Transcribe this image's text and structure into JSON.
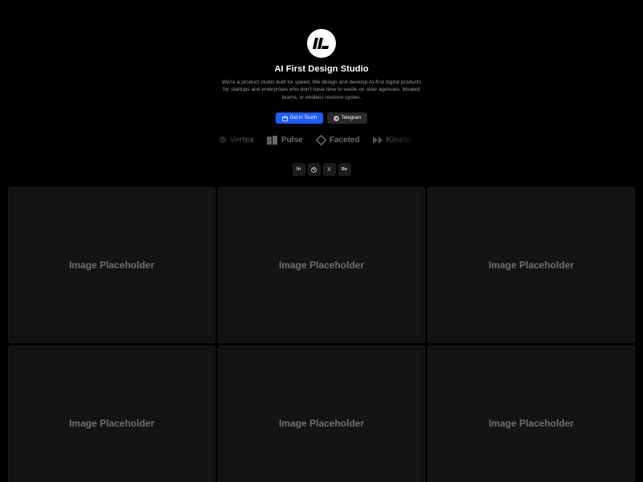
{
  "hero": {
    "title": "AI First Design Studio",
    "description": "We're a product studio built for speed. We design and develop AI-first digital products for startups and enterprises who don't have time to waste on slow agencies, bloated teams, or endless revision cycles.",
    "cta_primary": "Get in Touch",
    "cta_secondary": "Telegram",
    "cta_primary_color": "#1f5cff"
  },
  "logos": [
    {
      "name": "Vertex",
      "icon": "circle-icon"
    },
    {
      "name": "Pulse",
      "icon": "bars-icon"
    },
    {
      "name": "Faceted",
      "icon": "diamond-icon"
    },
    {
      "name": "Kineto",
      "icon": "fast-forward-icon"
    }
  ],
  "socials": [
    {
      "label": "in",
      "icon": "linkedin-icon"
    },
    {
      "label": "dribbble",
      "icon": "dribbble-icon"
    },
    {
      "label": "X",
      "icon": "x-icon"
    },
    {
      "label": "Be",
      "icon": "behance-icon"
    }
  ],
  "gallery": {
    "placeholder_label": "Image Placeholder",
    "items": [
      "Image Placeholder",
      "Image Placeholder",
      "Image Placeholder",
      "Image Placeholder",
      "Image Placeholder",
      "Image Placeholder"
    ]
  }
}
